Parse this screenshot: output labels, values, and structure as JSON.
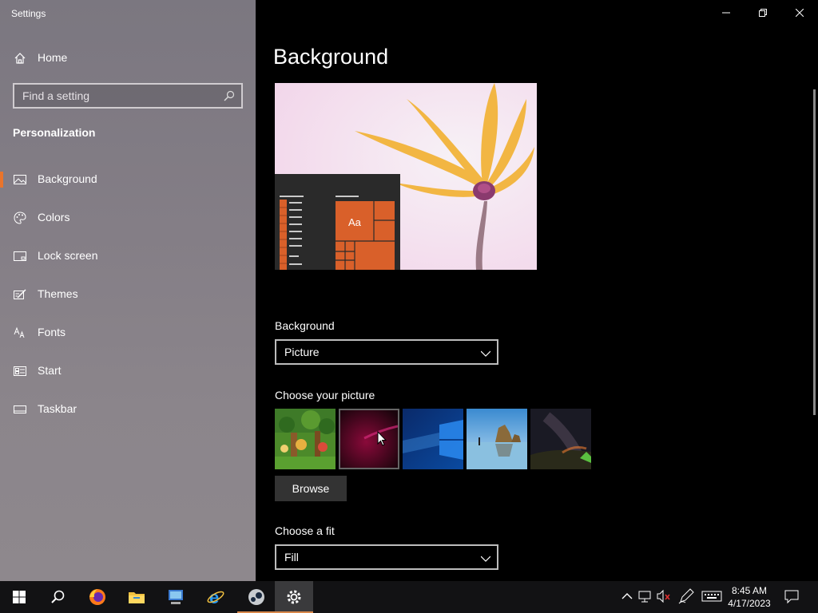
{
  "window": {
    "title": "Settings",
    "controls": [
      "minimize",
      "restore",
      "close"
    ]
  },
  "sidebar": {
    "home_label": "Home",
    "search_placeholder": "Find a setting",
    "section_title": "Personalization",
    "items": [
      {
        "label": "Background",
        "icon": "picture-icon",
        "selected": true
      },
      {
        "label": "Colors",
        "icon": "palette-icon",
        "selected": false
      },
      {
        "label": "Lock screen",
        "icon": "lock-screen-icon",
        "selected": false
      },
      {
        "label": "Themes",
        "icon": "themes-icon",
        "selected": false
      },
      {
        "label": "Fonts",
        "icon": "fonts-icon",
        "selected": false
      },
      {
        "label": "Start",
        "icon": "start-icon",
        "selected": false
      },
      {
        "label": "Taskbar",
        "icon": "taskbar-icon",
        "selected": false
      }
    ]
  },
  "main": {
    "title": "Background",
    "preview_text": "Aa",
    "background_label": "Background",
    "background_value": "Picture",
    "choose_picture_label": "Choose your picture",
    "browse_label": "Browse",
    "choose_fit_label": "Choose a fit",
    "fit_value": "Fill"
  },
  "taskbar": {
    "apps": [
      "start-icon",
      "search-icon",
      "firefox-icon",
      "file-explorer-icon",
      "control-panel-icon",
      "internet-explorer-icon",
      "steam-icon",
      "settings-icon"
    ],
    "time": "8:45 AM",
    "date": "4/17/2023"
  },
  "colors": {
    "accent": "#e9742b",
    "tile": "#d9602a"
  }
}
